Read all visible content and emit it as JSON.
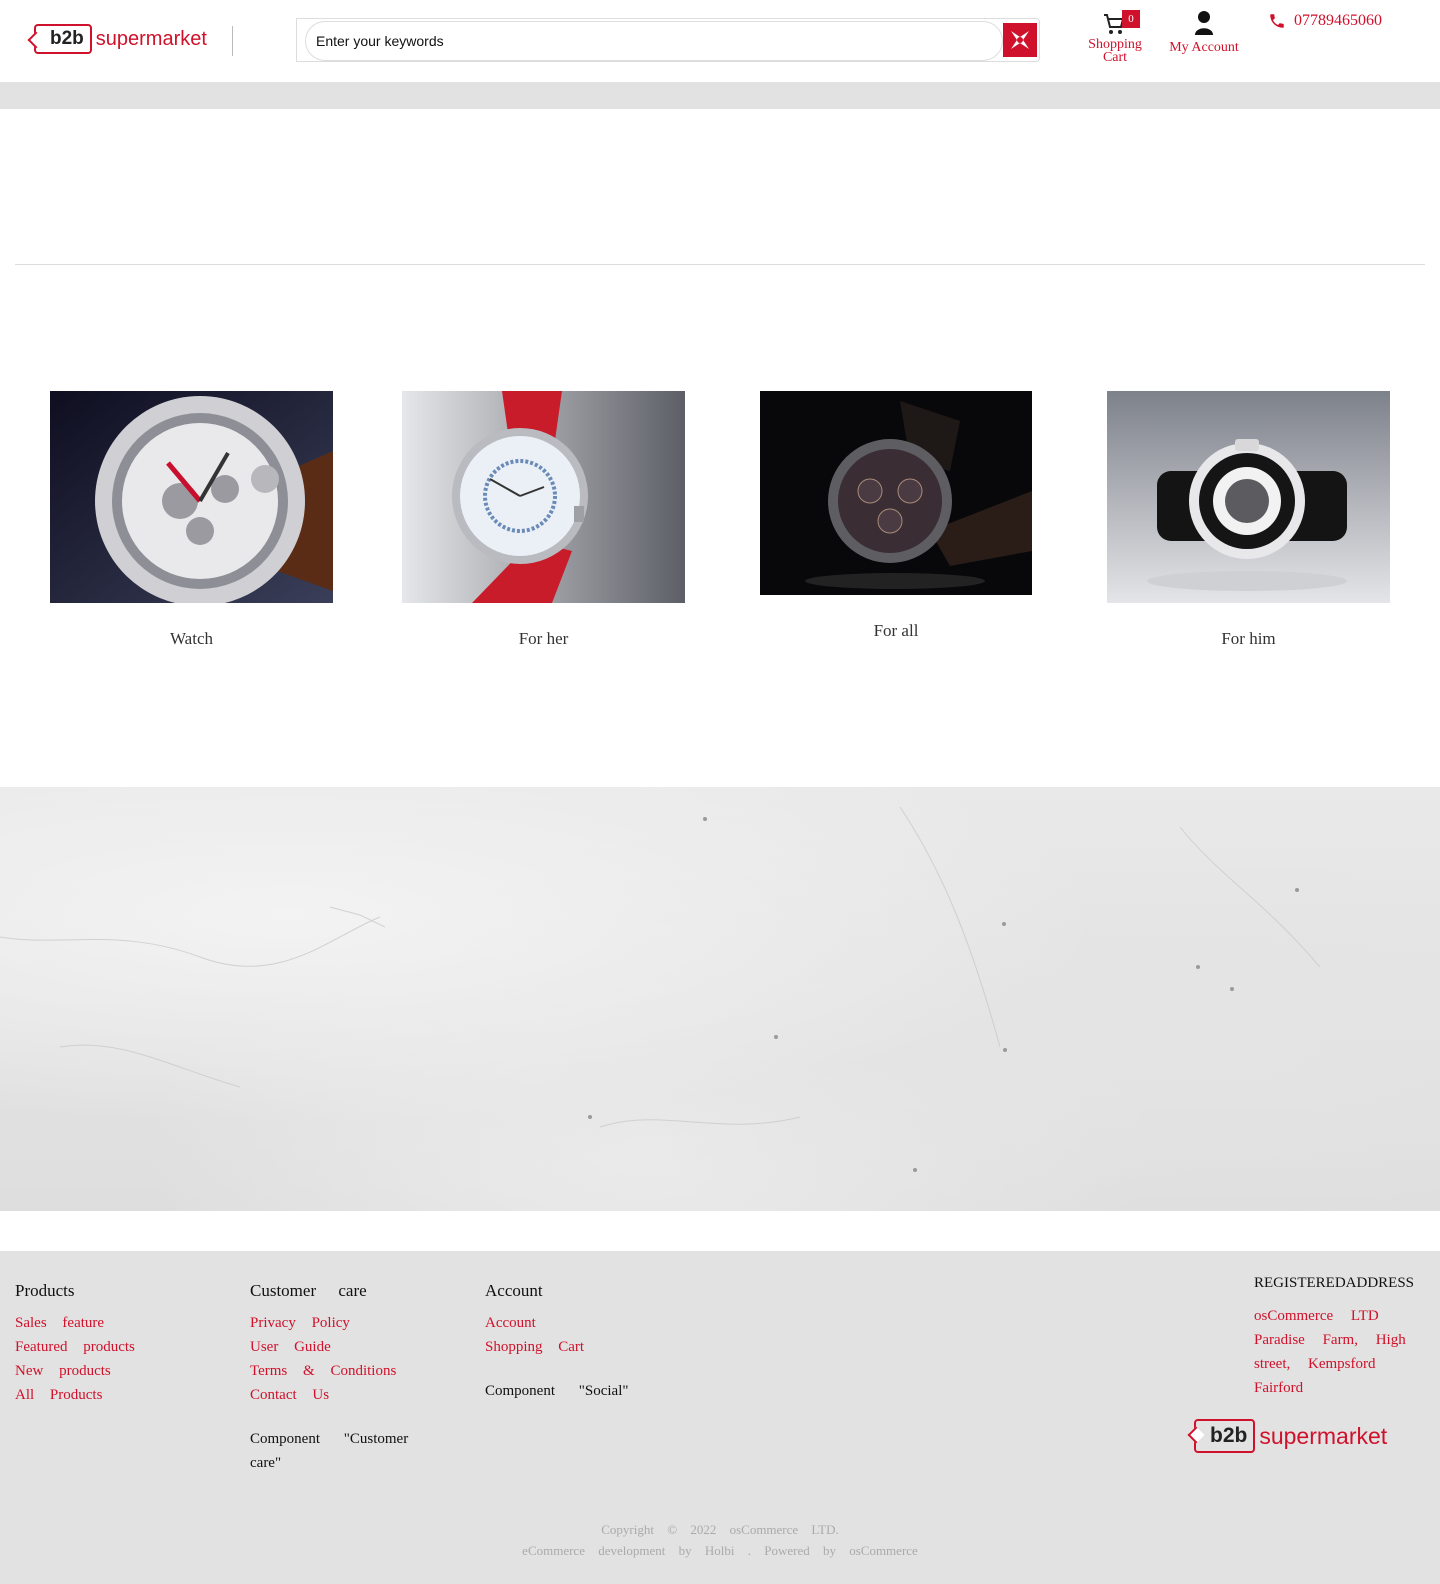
{
  "header": {
    "logo_b2b": "b2b",
    "logo_word": "supermarket",
    "search_placeholder": "Enter your keywords",
    "cart_count": "0",
    "cart_label_1": "Shopping",
    "cart_label_2": "Cart",
    "account_label": "My Account",
    "phone": "07789465060"
  },
  "categories": [
    {
      "label": "Watch"
    },
    {
      "label": "For her"
    },
    {
      "label": "For all"
    },
    {
      "label": "For him"
    }
  ],
  "footer": {
    "products": {
      "title": "Products",
      "links": [
        "Sales feature",
        "Featured products",
        "New products",
        "All Products"
      ]
    },
    "customer_care": {
      "title": "Customer care",
      "links": [
        "Privacy Policy",
        "User Guide",
        "Terms & Conditions",
        "Contact Us"
      ],
      "note": "Component \"Customer care\""
    },
    "account": {
      "title": "Account",
      "links": [
        "Account",
        "Shopping Cart"
      ],
      "note": "Component \"Social\""
    },
    "address": {
      "title": "REGISTEREDADDRESS",
      "text": "osCommerce LTD Paradise Farm, High street, Kempsford Fairford"
    },
    "logo_b2b": "b2b",
    "logo_word": "supermarket",
    "copyright_1": "Copyright © 2022 osCommerce LTD.",
    "copyright_2": "eCommerce development by Holbi . Powered by osCommerce"
  },
  "colors": {
    "accent": "#d0112b",
    "band": "#e2e2e2"
  }
}
